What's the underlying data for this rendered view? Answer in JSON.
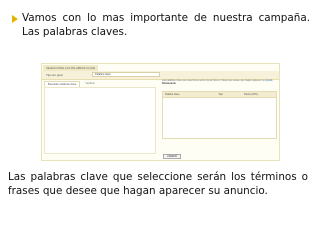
{
  "slide": {
    "bullet_text": "Vamos con lo mas importante de nuestra campaña. Las palabras claves.",
    "caption": "Las palabras clave que seleccione serán los términos o frases que desee que hagan aparecer su anuncio.",
    "bullet_color": "#e1b300"
  },
  "screenshot": {
    "title": "SELECCIONE LAS PALABRAS CLAVE",
    "search_label": "Tipo de ppal",
    "search_value": "Palabra clave",
    "tabs": [
      "Buscador palabras clave",
      "Verificar"
    ],
    "note_line1": "Las palabras clave que seleccione serán los términos o frases que desee que hagan aparecer su",
    "note_bold": "Restaurante",
    "note_link": "Ayuda",
    "columns": [
      "Palabra clave",
      "Tipo",
      "Oferta (CPC)"
    ],
    "button_label": "AÑADIR"
  }
}
